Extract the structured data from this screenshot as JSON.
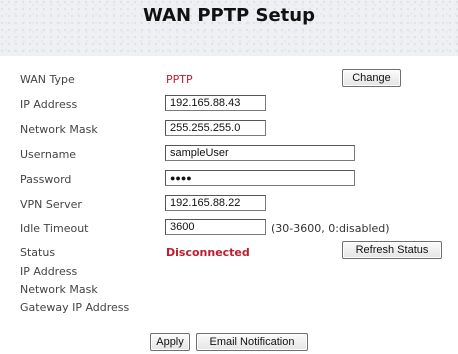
{
  "page": {
    "title": "WAN PPTP Setup"
  },
  "form": {
    "wan_type": {
      "label": "WAN Type",
      "value": "PPTP",
      "button": "Change"
    },
    "ip_address": {
      "label": "IP Address",
      "value": "192.165.88.43"
    },
    "network_mask": {
      "label": "Network Mask",
      "value": "255.255.255.0"
    },
    "username": {
      "label": "Username",
      "value": "sampleUser"
    },
    "password": {
      "label": "Password",
      "value": "●●●●"
    },
    "vpn_server": {
      "label": "VPN Server",
      "value": "192.165.88.22"
    },
    "idle_timeout": {
      "label": "Idle Timeout",
      "value": "3600",
      "hint": "(30-3600, 0:disabled)"
    },
    "status": {
      "label": "Status",
      "value": "Disconnected",
      "button": "Refresh Status"
    },
    "status_ip_address": {
      "label": "IP Address"
    },
    "status_network_mask": {
      "label": "Network Mask"
    },
    "status_gateway": {
      "label": "Gateway IP Address"
    }
  },
  "actions": {
    "apply": "Apply",
    "email": "Email Notification"
  },
  "colors": {
    "status_red": "#c01c2c",
    "header_bg": "#eef0f3"
  }
}
